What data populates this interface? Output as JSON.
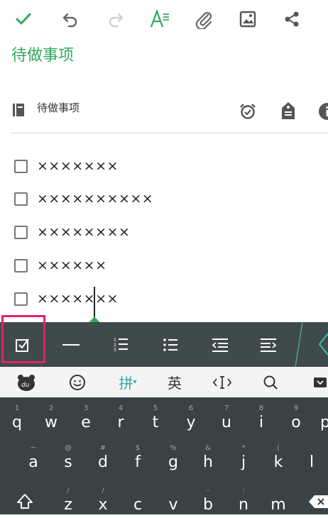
{
  "colors": {
    "accent": "#2eaa5e",
    "highlight": "#e0255e",
    "toolbar_dark": "#3f4a4d",
    "keyboard_bg": "#3a4245"
  },
  "top_toolbar": {
    "icons": [
      "check-icon",
      "undo-icon",
      "redo-icon",
      "text-format-icon",
      "attachment-icon",
      "image-icon",
      "share-icon"
    ]
  },
  "note": {
    "title": "待做事项",
    "notebook_name": "待做事项",
    "meta_icons": [
      "alarm-check-icon",
      "tag-icon",
      "info-icon"
    ]
  },
  "todos": [
    {
      "text": "×××××××",
      "checked": false
    },
    {
      "text": "××××××××××",
      "checked": false
    },
    {
      "text": "××××××××",
      "checked": false
    },
    {
      "text": "××××××",
      "checked": false
    },
    {
      "text": "×××××××",
      "checked": false
    }
  ],
  "format_bar": {
    "items": [
      "checkbox-icon",
      "horizontal-rule-icon",
      "numbered-list-icon",
      "bullet-list-icon",
      "outdent-icon",
      "indent-icon"
    ]
  },
  "keyboard_top": {
    "pinyin": "拼",
    "english": "英"
  },
  "keyboard": {
    "row1": [
      {
        "main": "q",
        "sub": "1"
      },
      {
        "main": "w",
        "sub": "2"
      },
      {
        "main": "e",
        "sub": "3"
      },
      {
        "main": "r",
        "sub": "4"
      },
      {
        "main": "t",
        "sub": "5"
      },
      {
        "main": "y",
        "sub": "6"
      },
      {
        "main": "u",
        "sub": "7"
      },
      {
        "main": "i",
        "sub": "8"
      },
      {
        "main": "o",
        "sub": "9"
      },
      {
        "main": "p",
        "sub": ""
      }
    ],
    "row2": [
      {
        "main": "a",
        "sub": "~"
      },
      {
        "main": "s",
        "sub": "@"
      },
      {
        "main": "d",
        "sub": "#"
      },
      {
        "main": "f",
        "sub": "$"
      },
      {
        "main": "g",
        "sub": "%"
      },
      {
        "main": "h",
        "sub": "&"
      },
      {
        "main": "j",
        "sub": "*"
      },
      {
        "main": "k",
        "sub": "("
      },
      {
        "main": "l",
        "sub": ""
      }
    ],
    "row3": [
      {
        "main": "z",
        "sub": "/"
      },
      {
        "main": "x",
        "sub": "/"
      },
      {
        "main": "c",
        "sub": ""
      },
      {
        "main": "v",
        "sub": ""
      },
      {
        "main": "b",
        "sub": "-"
      },
      {
        "main": "n",
        "sub": ":"
      },
      {
        "main": "m",
        "sub": ""
      }
    ]
  }
}
